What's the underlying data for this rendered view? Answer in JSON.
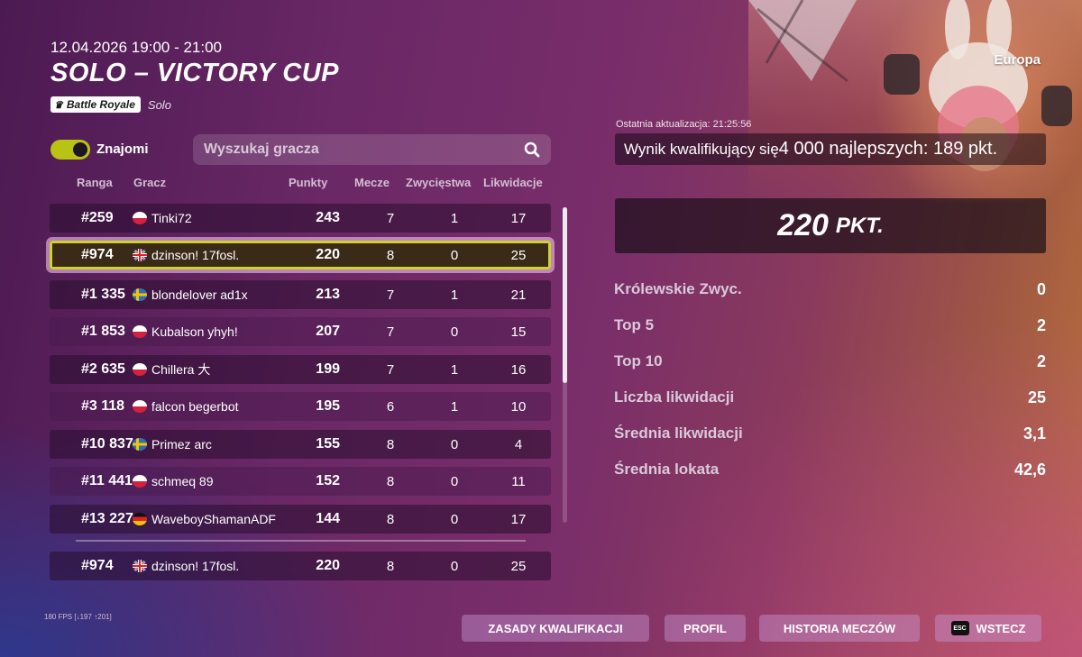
{
  "header": {
    "date": "12.04.2026 19:00 - 21:00",
    "title": "SOLO – VICTORY CUP",
    "mode_badge": "Battle Royale",
    "mode_sub": "Solo",
    "region": "Europa"
  },
  "filters": {
    "friends_label": "Znajomi",
    "friends_on": true,
    "search_placeholder": "Wyszukaj gracza"
  },
  "columns": {
    "rank": "Ranga",
    "player": "Gracz",
    "points": "Punkty",
    "matches": "Mecze",
    "wins": "Zwycięstwa",
    "elims": "Likwidacje"
  },
  "rows": [
    {
      "rank": "#259",
      "flag": "pl",
      "name": "Tinki72",
      "points": "243",
      "matches": "7",
      "wins": "1",
      "elims": "17"
    },
    {
      "rank": "#974",
      "flag": "gb",
      "name": "dzinson! 17fosl.",
      "points": "220",
      "matches": "8",
      "wins": "0",
      "elims": "25",
      "selected": true
    },
    {
      "rank": "#1 335",
      "flag": "se",
      "name": "blondelover ad1x",
      "points": "213",
      "matches": "7",
      "wins": "1",
      "elims": "21"
    },
    {
      "rank": "#1 853",
      "flag": "pl",
      "name": "Kubalson yhyh!",
      "points": "207",
      "matches": "7",
      "wins": "0",
      "elims": "15"
    },
    {
      "rank": "#2 635",
      "flag": "pl",
      "name": "Chillera 大",
      "points": "199",
      "matches": "7",
      "wins": "1",
      "elims": "16"
    },
    {
      "rank": "#3 118",
      "flag": "pl",
      "name": "falcon begerbot",
      "points": "195",
      "matches": "6",
      "wins": "1",
      "elims": "10"
    },
    {
      "rank": "#10 837",
      "flag": "se",
      "name": "Primez arc",
      "points": "155",
      "matches": "8",
      "wins": "0",
      "elims": "4"
    },
    {
      "rank": "#11 441",
      "flag": "pl",
      "name": "schmeq 89",
      "points": "152",
      "matches": "8",
      "wins": "0",
      "elims": "11"
    },
    {
      "rank": "#13 227",
      "flag": "de",
      "name": "WaveboyShamanADF",
      "points": "144",
      "matches": "8",
      "wins": "0",
      "elims": "17"
    }
  ],
  "my_row": {
    "rank": "#974",
    "flag": "gb",
    "name": "dzinson! 17fosl.",
    "points": "220",
    "matches": "8",
    "wins": "0",
    "elims": "25"
  },
  "summary": {
    "last_update": "Ostatnia aktualizacja: 21:25:56",
    "qual_text_a": "Wynik kwalifikujący się",
    "qual_text_b": "4 000 najlepszych: 189 pkt.",
    "score": "220",
    "score_unit": "PKT."
  },
  "stats": [
    {
      "label": "Królewskie Zwyc.",
      "value": "0"
    },
    {
      "label": "Top 5",
      "value": "2"
    },
    {
      "label": "Top 10",
      "value": "2"
    },
    {
      "label": "Liczba likwidacji",
      "value": "25"
    },
    {
      "label": "Średnia likwidacji",
      "value": "3,1"
    },
    {
      "label": "Średnia lokata",
      "value": "42,6"
    }
  ],
  "footer": {
    "fps": "180 FPS [↓197 ↑201]",
    "btn_rules": "ZASADY KWALIFIKACJI",
    "btn_profile": "PROFIL",
    "btn_history": "HISTORIA MECZÓW",
    "btn_back_key": "ESC",
    "btn_back": "WSTECZ"
  },
  "colors": {
    "accent_toggle": "#b9c313",
    "selected_outline": "#cfd22c"
  }
}
